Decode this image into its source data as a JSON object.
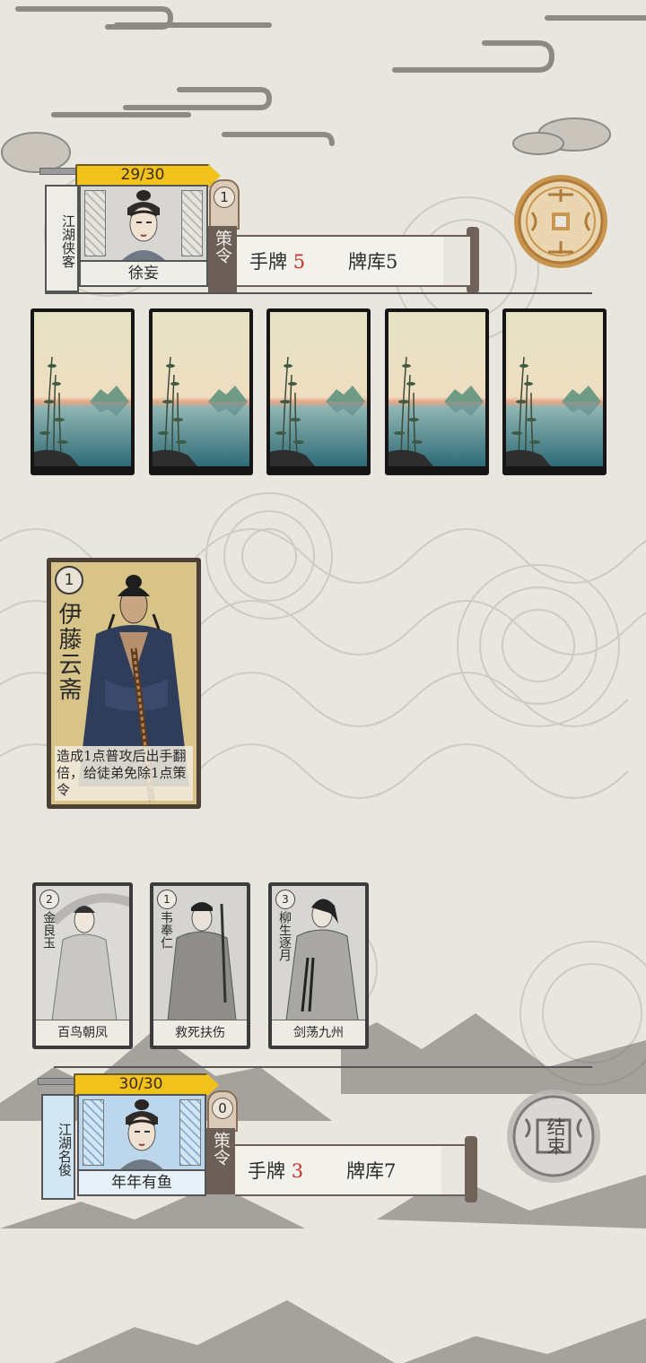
{
  "opponent": {
    "hp": "29/30",
    "title": "江湖侠客",
    "name": "徐妄",
    "command_points": "1",
    "command_label": "策令",
    "hand_label": "手牌",
    "hand_count": "5",
    "deck_label": "牌库",
    "deck_count": "5",
    "facedown_cards": 5
  },
  "played_card": {
    "cost": "1",
    "name": "伊藤云斋",
    "description": "造成1点普攻后出手翻倍，给徒弟免除1点策令"
  },
  "hand_cards": [
    {
      "cost": "2",
      "name": "金良玉",
      "skill": "百鸟朝凤"
    },
    {
      "cost": "1",
      "name": "韦奉仁",
      "skill": "救死扶伤"
    },
    {
      "cost": "3",
      "name": "柳生逐月",
      "skill": "剑荡九州"
    }
  ],
  "player": {
    "hp": "30/30",
    "title": "江湖名俊",
    "name": "年年有鱼",
    "command_points": "0",
    "command_label": "策令",
    "hand_label": "手牌",
    "hand_count": "3",
    "deck_label": "牌库",
    "deck_count": "7"
  },
  "end_turn_button": "结束",
  "colors": {
    "hp_yellow": "#f2c21c",
    "accent_red": "#c5312a",
    "coin_gold": "#c8964f"
  }
}
